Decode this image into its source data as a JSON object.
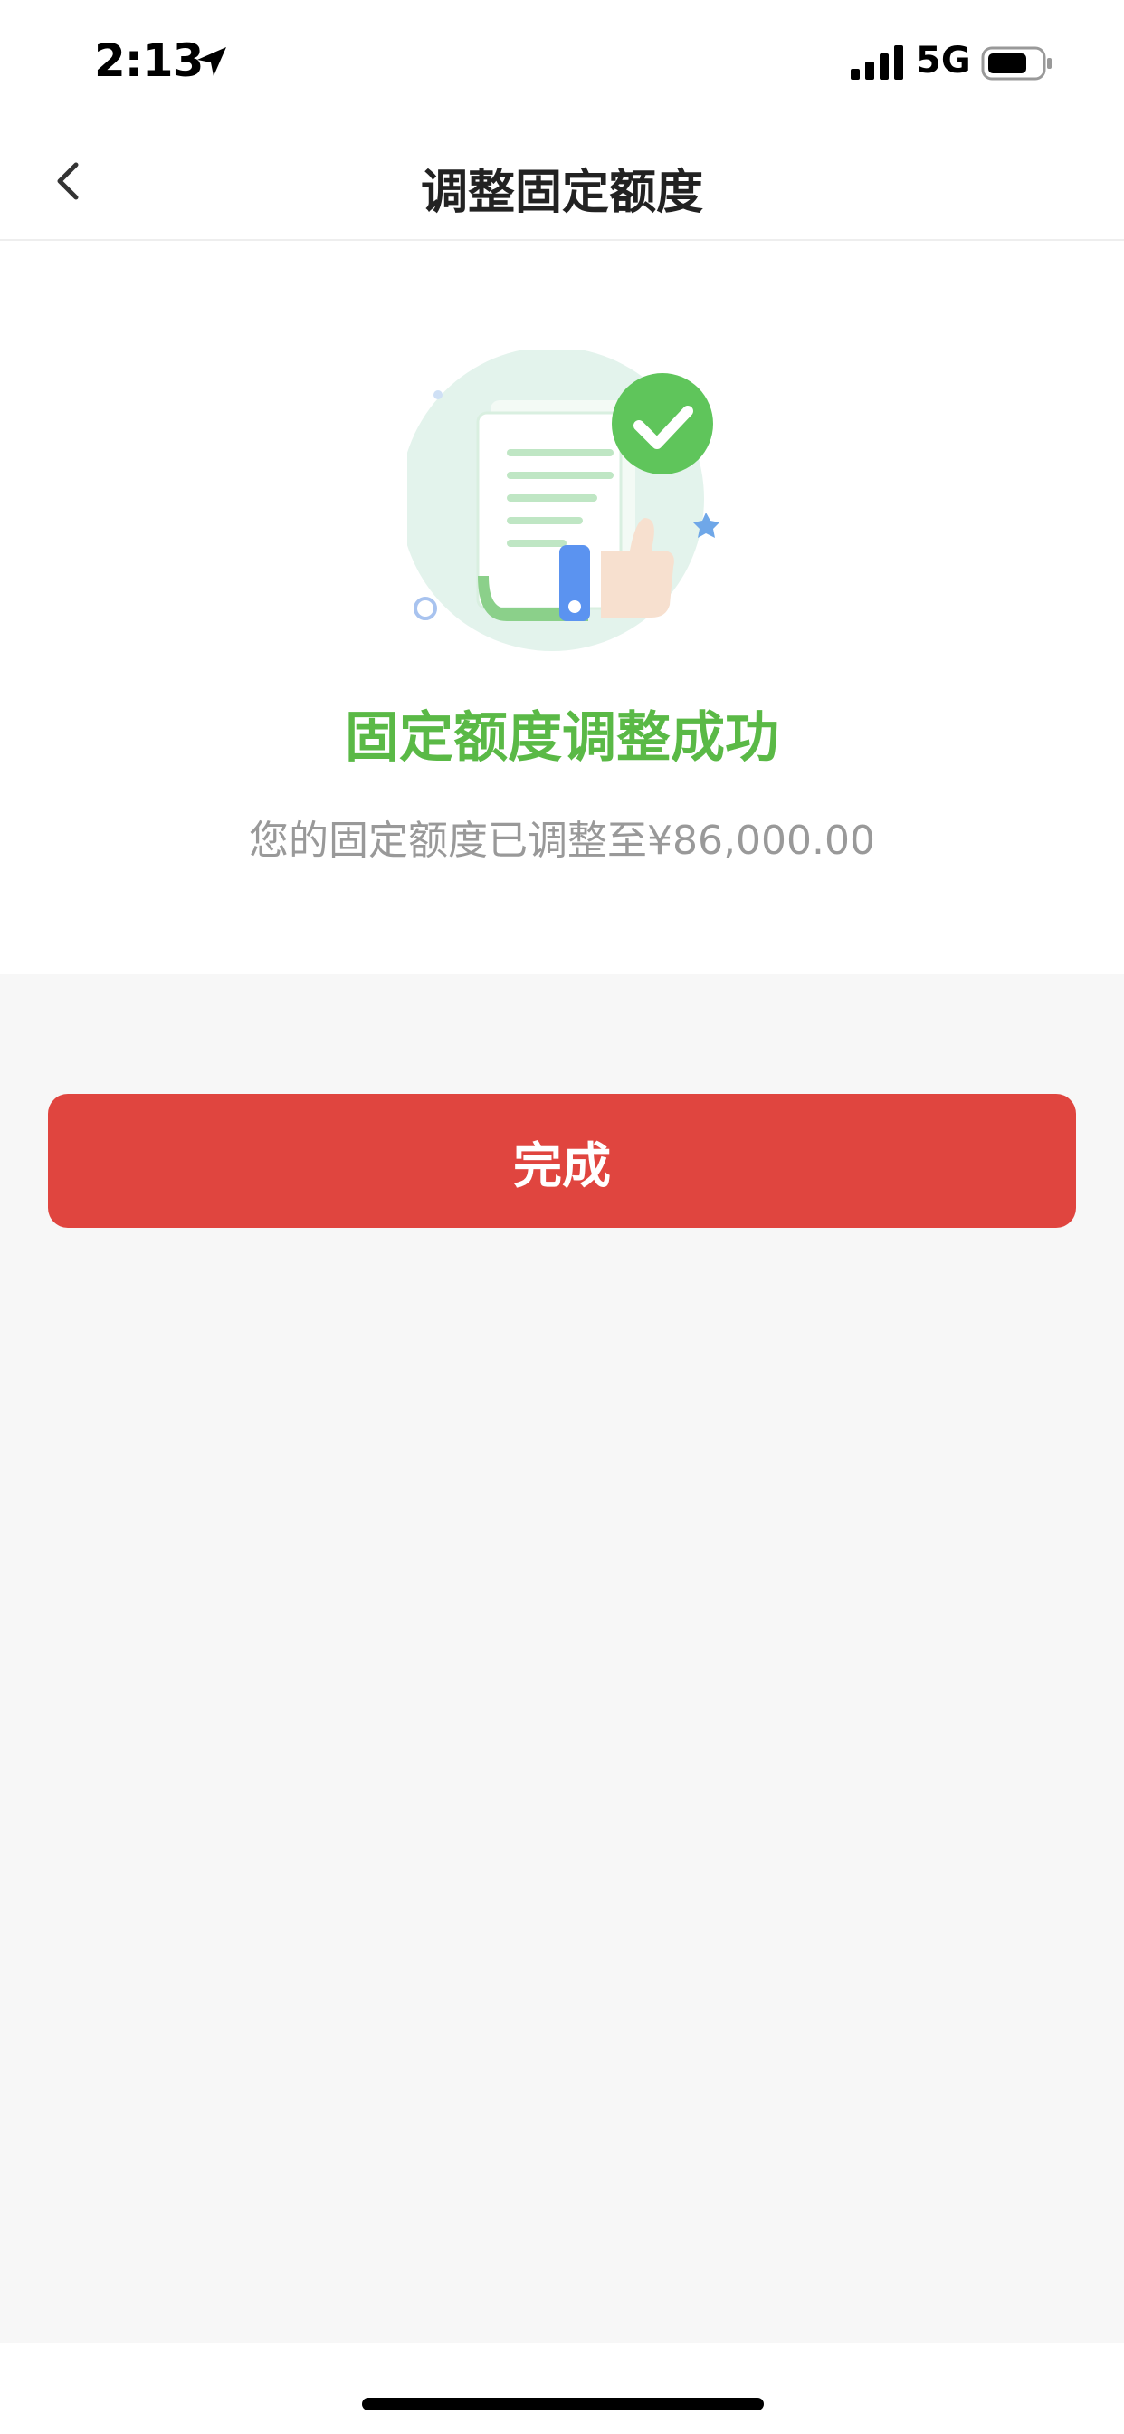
{
  "status_bar": {
    "time": "2:13",
    "network": "5G",
    "icons": [
      "location-arrow-icon",
      "signal-icon",
      "battery-icon"
    ]
  },
  "nav": {
    "title": "调整固定额度",
    "back_icon": "chevron-left-icon"
  },
  "result": {
    "illustration": "document-thumbs-up-check-icon",
    "title": "固定额度调整成功",
    "description": "您的固定额度已调整至¥86,000.00"
  },
  "actions": {
    "done_label": "完成"
  },
  "colors": {
    "success_green": "#5ab946",
    "primary_red": "#e0453f",
    "page_bg": "#f7f7f7",
    "secondary_text": "#999999"
  }
}
